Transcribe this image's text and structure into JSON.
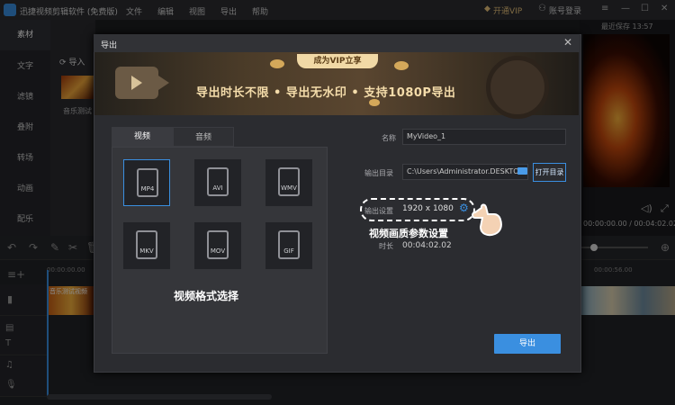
{
  "app": {
    "title": "迅捷视频剪辑软件 (免费版)",
    "menu": [
      "文件",
      "编辑",
      "视图",
      "导出",
      "帮助"
    ],
    "vip": "开通VIP",
    "account": "账号登录"
  },
  "sidebar": {
    "items": [
      "素材",
      "文字",
      "滤镜",
      "叠附",
      "转场",
      "动画",
      "配乐"
    ],
    "active_index": 0
  },
  "media": {
    "import_label": "导入",
    "clip_caption": "音乐测试"
  },
  "preview": {
    "autosave": "最近保存 13:57",
    "timecode": "00:00:00.00 / 00:04:02.02"
  },
  "timeline": {
    "ruler_start": "00:00:00.00",
    "ruler_mark": "00:00:56.00",
    "clip_label": "音乐测试视频"
  },
  "dialog": {
    "title": "导出",
    "banner_badge": "成为VIP立享",
    "banner_text": "导出时长不限 • 导出无水印 • 支持1080P导出",
    "tabs": [
      "视频",
      "音频"
    ],
    "formats": [
      "MP4",
      "AVI",
      "WMV",
      "MKV",
      "MOV",
      "GIF"
    ],
    "selected_format": "MP4",
    "format_caption": "视频格式选择",
    "name_label": "名称",
    "name_value": "MyVideo_1",
    "dir_label": "输出目录",
    "dir_value": "C:\\Users\\Administrator.DESKTOP-",
    "open_dir": "打开目录",
    "output_label": "输出设置",
    "resolution": "1920 x 1080",
    "quality_caption": "视频画质参数设置",
    "duration_label": "时长",
    "duration_value": "00:04:02.02",
    "export_button": "导出"
  },
  "colors": {
    "accent": "#3a8fe0",
    "banner_gold": "#f4dcaa"
  }
}
